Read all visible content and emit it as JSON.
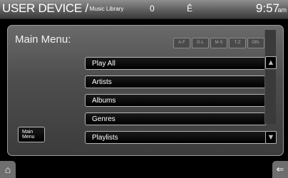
{
  "header": {
    "title": "USER DEVICE /",
    "subtitle": "Music Library",
    "status_icon_1": "0",
    "status_icon_2": "Ê",
    "time": "9:57",
    "ampm": "am"
  },
  "panel": {
    "menu_title": "Main Menu:",
    "alpha_tabs": [
      "A-F",
      "G-L",
      "M-S",
      "T-Z",
      "Oth."
    ],
    "items": [
      "Play All",
      "Artists",
      "Albums",
      "Genres",
      "Playlists"
    ],
    "main_menu_button": "Main Menu"
  },
  "icons": {
    "scroll_up": "up-arrow-icon",
    "scroll_down": "down-arrow-icon",
    "home": "home-icon",
    "back": "back-icon"
  }
}
